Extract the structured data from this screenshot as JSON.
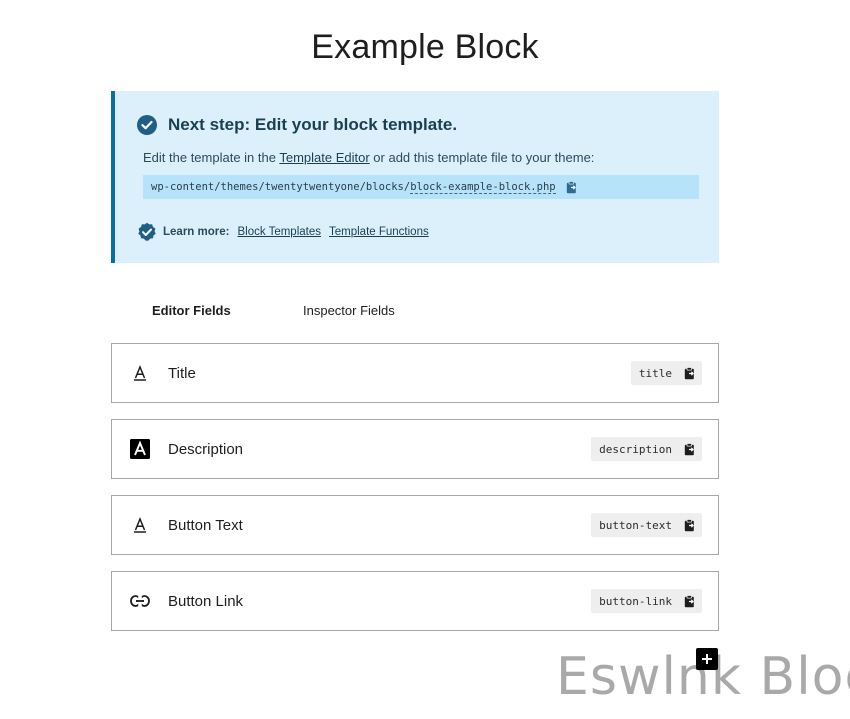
{
  "page": {
    "title": "Example Block"
  },
  "notice": {
    "title": "Next step: Edit your block template.",
    "desc_prefix": "Edit the template in the ",
    "editor_link": "Template Editor",
    "desc_suffix": " or add this template file to your theme:",
    "path_dir": "wp-content/themes/twentytwentyone/blocks/",
    "path_file": "block-example-block.php",
    "learn_label": "Learn more:",
    "link_block_templates": "Block Templates",
    "link_template_functions": "Template Functions"
  },
  "tabs": {
    "editor": "Editor Fields",
    "inspector": "Inspector Fields",
    "active": "editor"
  },
  "fields": [
    {
      "label": "Title",
      "slug": "title",
      "icon": "text-icon"
    },
    {
      "label": "Description",
      "slug": "description",
      "icon": "textarea-icon"
    },
    {
      "label": "Button Text",
      "slug": "button-text",
      "icon": "text-icon"
    },
    {
      "label": "Button Link",
      "slug": "button-link",
      "icon": "link-icon"
    }
  ],
  "watermark": "Eswlnk Blog",
  "colors": {
    "notice_bg": "#dcf0fb",
    "notice_border": "#0a6ea5",
    "path_bg": "#b7e3fa",
    "check": "#0a6ea5"
  }
}
